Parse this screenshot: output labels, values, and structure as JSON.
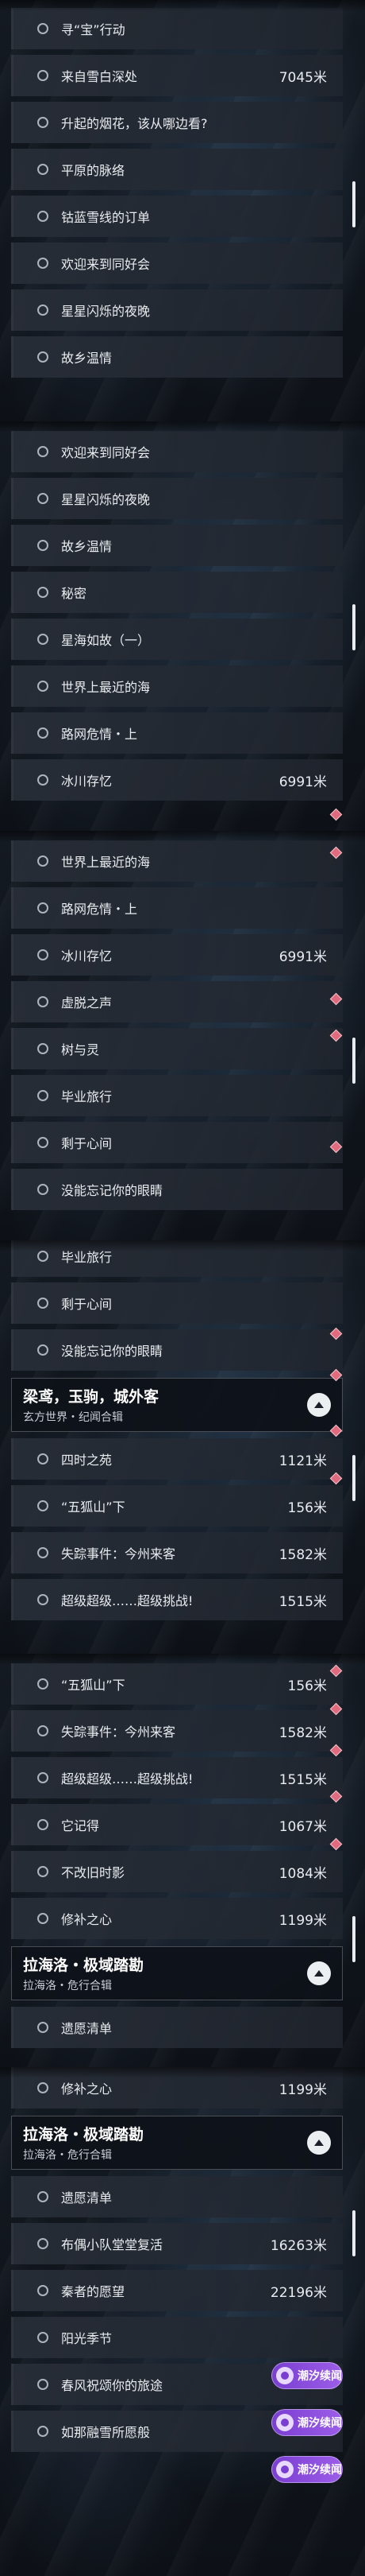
{
  "screens": [
    {
      "items": [
        {
          "label": "寻“宝”行动",
          "dist": ""
        },
        {
          "label": "来自雪白深处",
          "dist": "7045米"
        },
        {
          "label": "升起的烟花，该从哪边看?",
          "dist": ""
        },
        {
          "label": "平原的脉络",
          "dist": ""
        },
        {
          "label": "钴蓝雪线的订单",
          "dist": ""
        },
        {
          "label": "欢迎来到同好会",
          "dist": ""
        },
        {
          "label": "星星闪烁的夜晚",
          "dist": ""
        },
        {
          "label": "故乡温情",
          "dist": ""
        }
      ]
    },
    {
      "items": [
        {
          "label": "欢迎来到同好会",
          "dist": ""
        },
        {
          "label": "星星闪烁的夜晚",
          "dist": ""
        },
        {
          "label": "故乡温情",
          "dist": ""
        },
        {
          "label": "秘密",
          "dist": ""
        },
        {
          "label": "星海如故（一）",
          "dist": ""
        },
        {
          "label": "世界上最近的海",
          "dist": ""
        },
        {
          "label": "路网危情・上",
          "dist": ""
        },
        {
          "label": "冰川存忆",
          "dist": "6991米"
        }
      ]
    },
    {
      "items": [
        {
          "label": "世界上最近的海",
          "dist": ""
        },
        {
          "label": "路网危情・上",
          "dist": ""
        },
        {
          "label": "冰川存忆",
          "dist": "6991米"
        },
        {
          "label": "虚脱之声",
          "dist": ""
        },
        {
          "label": "树与灵",
          "dist": ""
        },
        {
          "label": "毕业旅行",
          "dist": ""
        },
        {
          "label": "剩于心间",
          "dist": ""
        },
        {
          "label": "没能忘记你的眼睛",
          "dist": ""
        }
      ]
    },
    {
      "items": [
        {
          "label": "毕业旅行",
          "dist": ""
        },
        {
          "label": "剩于心间",
          "dist": ""
        },
        {
          "label": "没能忘记你的眼睛",
          "dist": ""
        }
      ],
      "group": {
        "title": "梁鸢，玉驹，城外客",
        "subtitle": "玄方世界・纪闻合辑"
      },
      "items2": [
        {
          "label": "四时之苑",
          "dist": "1121米"
        },
        {
          "label": "“五狐山”下",
          "dist": "156米"
        },
        {
          "label": "失踪事件：今州来客",
          "dist": "1582米"
        },
        {
          "label": "超级超级……超级挑战!",
          "dist": "1515米"
        }
      ]
    },
    {
      "items": [
        {
          "label": "“五狐山”下",
          "dist": "156米"
        },
        {
          "label": "失踪事件：今州来客",
          "dist": "1582米"
        },
        {
          "label": "超级超级……超级挑战!",
          "dist": "1515米"
        },
        {
          "label": "它记得",
          "dist": "1067米"
        },
        {
          "label": "不改旧时影",
          "dist": "1084米"
        },
        {
          "label": "修补之心",
          "dist": "1199米"
        }
      ],
      "group": {
        "title": "拉海洛・极域踏勘",
        "subtitle": "拉海洛・危行合辑"
      },
      "items2": [
        {
          "label": "遗愿清单",
          "dist": ""
        }
      ]
    },
    {
      "items": [
        {
          "label": "修补之心",
          "dist": "1199米"
        }
      ],
      "group": {
        "title": "拉海洛・极域踏勘",
        "subtitle": "拉海洛・危行合辑"
      },
      "items2": [
        {
          "label": "遗愿清单",
          "dist": ""
        },
        {
          "label": "布偶小队堂堂复活",
          "dist": "16263米"
        },
        {
          "label": "秦者的愿望",
          "dist": "22196米"
        },
        {
          "label": "阳光季节",
          "dist": ""
        },
        {
          "label": "春风祝颂你的旅途",
          "dist": ""
        },
        {
          "label": "如那融雪所愿般",
          "dist": ""
        }
      ],
      "badge": "潮汐续闻"
    }
  ]
}
